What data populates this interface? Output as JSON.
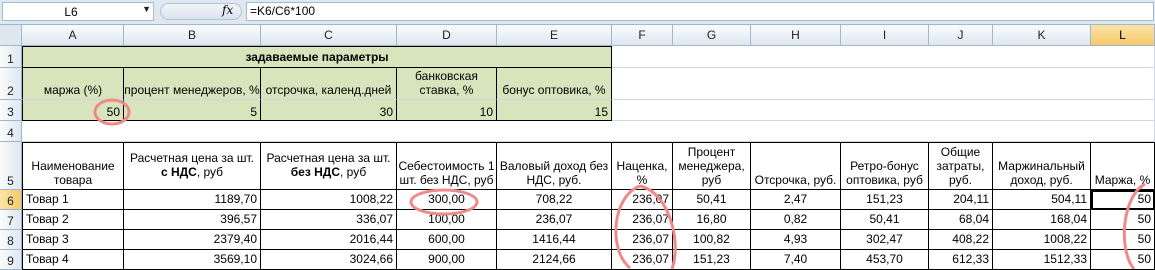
{
  "formula_bar": {
    "name_box": "L6",
    "fx_label": "fx",
    "formula": "=K6/C6*100"
  },
  "columns": [
    "A",
    "B",
    "C",
    "D",
    "E",
    "F",
    "G",
    "H",
    "I",
    "J",
    "K",
    "L"
  ],
  "rows": [
    "1",
    "2",
    "3",
    "4",
    "5",
    "6",
    "7",
    "8",
    "9"
  ],
  "params": {
    "title": "задаваемые параметры",
    "headers": [
      "маржа (%)",
      "процент менеджеров, %",
      "отсрочка, календ.дней",
      "банковская ставка, %",
      "бонус оптовика, %"
    ],
    "values": [
      "50",
      "5",
      "30",
      "10",
      "15"
    ]
  },
  "table": {
    "headers": {
      "A": "Наименование товара",
      "B_line1": "Расчетная цена за шт.",
      "B_bold": "с НДС",
      "B_tail": ", руб",
      "C_line1": "Расчетная цена за шт.",
      "C_bold": "без НДС",
      "C_tail": ", руб",
      "D": "Себестоимость 1 шт. без НДС, руб",
      "E": "Валовый доход без НДС, руб.",
      "F": "Наценка, %",
      "G": "Процент менеджера, руб",
      "H": "Отсрочка, руб.",
      "I": "Ретро-бонус оптовика, руб",
      "J": "Общие затраты, руб.",
      "K": "Маржинальный доход, руб.",
      "L": "Маржа, %"
    },
    "rows": [
      [
        "Товар 1",
        "1189,70",
        "1008,22",
        "300,00",
        "708,22",
        "236,07",
        "50,41",
        "2,47",
        "151,23",
        "204,11",
        "504,11",
        "50"
      ],
      [
        "Товар 2",
        "396,57",
        "336,07",
        "100,00",
        "236,07",
        "236,07",
        "16,80",
        "0,82",
        "50,41",
        "68,04",
        "168,04",
        "50"
      ],
      [
        "Товар 3",
        "2379,40",
        "2016,44",
        "600,00",
        "1416,44",
        "236,07",
        "100,82",
        "4,93",
        "302,47",
        "408,22",
        "1008,22",
        "50"
      ],
      [
        "Товар 4",
        "3569,10",
        "3024,66",
        "900,00",
        "2124,66",
        "236,07",
        "151,23",
        "7,40",
        "453,70",
        "612,33",
        "1512,33",
        "50"
      ]
    ]
  },
  "colors": {
    "param_fill": "#d8e4bc",
    "annotation": "#f08080",
    "selection_header": "#f6c96a"
  }
}
